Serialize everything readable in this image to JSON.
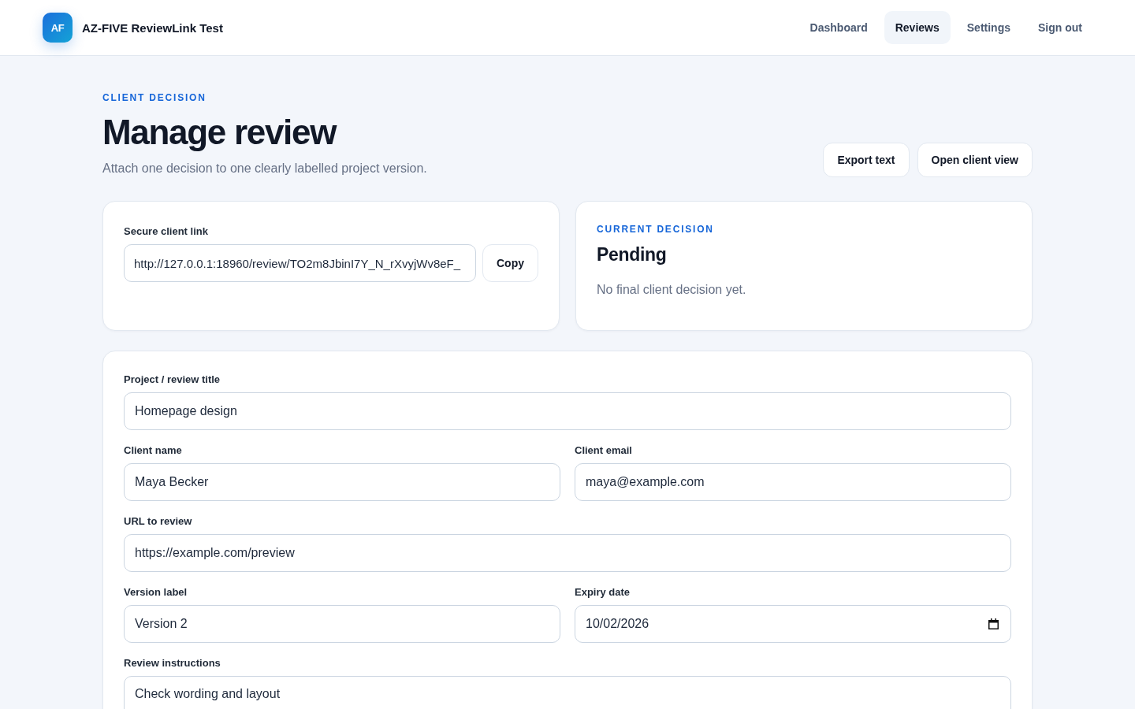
{
  "header": {
    "logo": "AF",
    "title": "AZ-FIVE ReviewLink Test",
    "nav": [
      {
        "label": "Dashboard",
        "selected": false
      },
      {
        "label": "Reviews",
        "selected": true
      },
      {
        "label": "Settings",
        "selected": false
      },
      {
        "label": "Sign out",
        "selected": false
      }
    ]
  },
  "page": {
    "eyebrow": "CLIENT DECISION",
    "title": "Manage review",
    "subtitle": "Attach one decision to one clearly labelled project version.",
    "actions": [
      "Export text",
      "Open client view"
    ]
  },
  "link_card": {
    "label": "Secure client link",
    "value": "http://127.0.0.1:18960/review/TO2m8JbinI7Y_N_rXvyjWv8eF_",
    "button": "Copy"
  },
  "decision_card": {
    "eyebrow": "CURRENT DECISION",
    "status": "Pending",
    "note": "No final client decision yet."
  },
  "form": {
    "rows": [
      [
        {
          "kind": "text",
          "label": "Project / review title",
          "value": "Homepage design"
        }
      ],
      [
        {
          "kind": "text",
          "label": "Client name",
          "value": "Maya Becker"
        },
        {
          "kind": "text",
          "label": "Client email",
          "value": "maya@example.com"
        }
      ],
      [
        {
          "kind": "text",
          "label": "URL to review",
          "value": "https://example.com/preview"
        }
      ],
      [
        {
          "kind": "text",
          "label": "Version label",
          "value": "Version 2"
        },
        {
          "kind": "date",
          "label": "Expiry date",
          "value": "10/02/2026"
        }
      ],
      [
        {
          "kind": "textarea",
          "label": "Review instructions",
          "value": "Check wording and layout"
        }
      ]
    ]
  }
}
